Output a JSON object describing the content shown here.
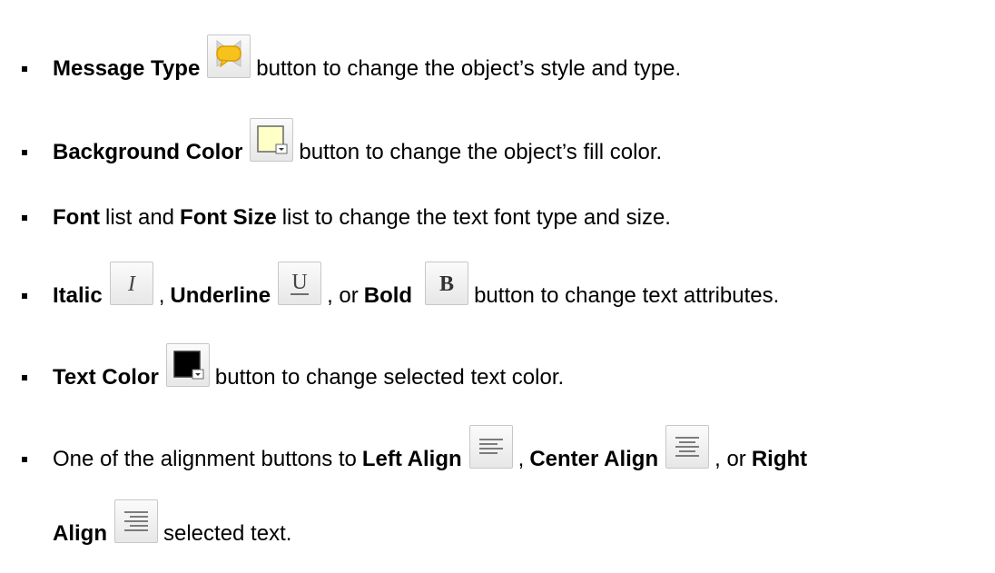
{
  "items": [
    {
      "bold": "Message Type",
      "icon": "message-type-icon",
      "rest": "button to change the object’s style and type."
    },
    {
      "bold": "Background Color",
      "icon": "background-color-icon",
      "rest": "button to change the object’s fill color."
    },
    {
      "bold1": "Font",
      "mid1": "list and",
      "bold2": "Font Size",
      "rest": "list to change the text font type and size."
    },
    {
      "bold1": "Italic",
      "sep1": ",",
      "bold2": "Underline",
      "sep2": ", or",
      "bold3": "Bold",
      "rest": "button to change text attributes.",
      "italic_glyph": "I",
      "underline_glyph": "U",
      "bold_glyph": "B"
    },
    {
      "bold": "Text Color",
      "icon": "text-color-icon",
      "rest": "button to change selected text color."
    },
    {
      "lead": "One of the alignment buttons to",
      "bold1": "Left Align",
      "sep1": ",",
      "bold2": "Center Align",
      "sep2": ", or",
      "bold3": "Right",
      "bold3b": "Align",
      "rest": "selected text."
    }
  ],
  "colors": {
    "message_bubble": "#f7c21b",
    "background_swatch": "#ffffc8",
    "text_swatch": "#000000"
  }
}
